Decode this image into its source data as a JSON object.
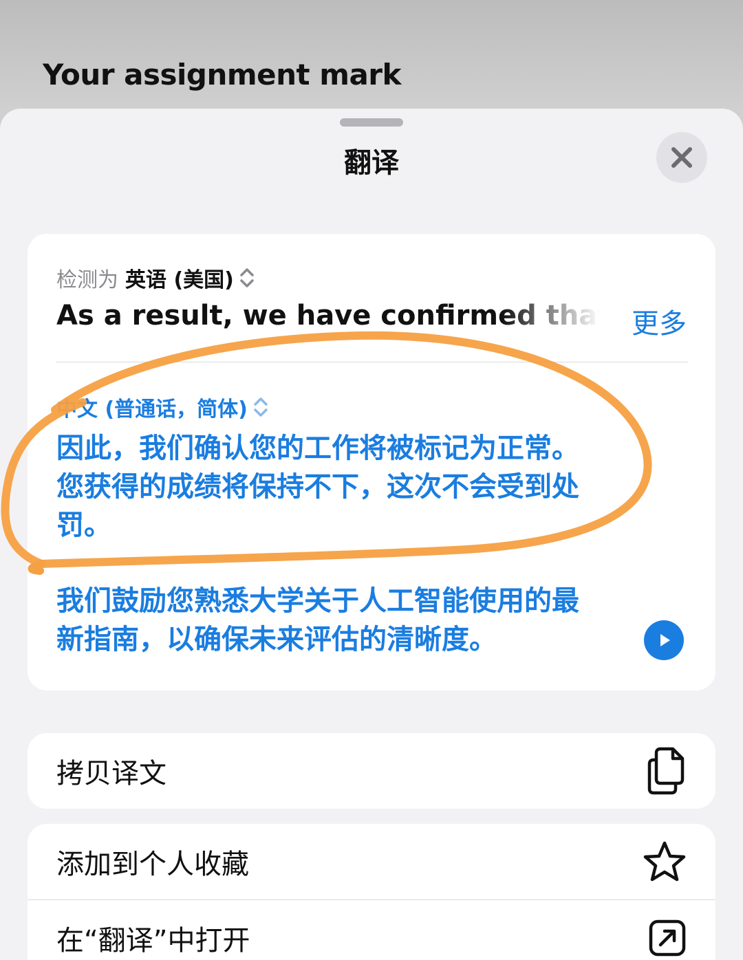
{
  "background": {
    "title": "Your assignment mark"
  },
  "sheet": {
    "title": "翻译",
    "close_icon": "close-icon"
  },
  "translation_card": {
    "detected_label": "检测为",
    "detected_language": "英语 (美国)",
    "source_text": "As a result, we have confirmed that y",
    "more_label": "更多",
    "target_language": "中文 (普通话，简体)",
    "paragraphs": [
      "因此，我们确认您的工作将被标记为正常。您获得的成绩将保持不下，这次不会受到处罚。",
      "我们鼓励您熟悉大学关于人工智能使用的最新指南，以确保未来评估的清晰度。"
    ],
    "play_icon": "play-icon"
  },
  "actions": [
    {
      "label": "拷贝译文",
      "icon": "copy-icon"
    },
    {
      "label": "添加到个人收藏",
      "icon": "star-icon"
    },
    {
      "label": "在“翻译”中打开",
      "icon": "open-external-icon"
    }
  ],
  "colors": {
    "accent": "#1a7de0",
    "annotation": "#f5a042",
    "sheet_bg": "#f2f2f4"
  }
}
